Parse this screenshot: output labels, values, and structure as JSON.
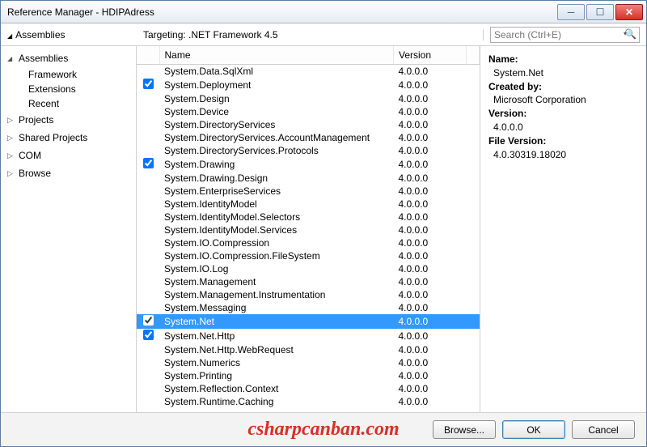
{
  "window": {
    "title": "Reference Manager - HDIPAdress"
  },
  "toprow": {
    "assemblies_label": "Assemblies",
    "targeting": "Targeting: .NET Framework 4.5",
    "search_placeholder": "Search (Ctrl+E)"
  },
  "sidebar": {
    "categories": [
      {
        "label": "Assemblies",
        "expanded": true,
        "children": [
          {
            "label": "Framework",
            "selected": true
          },
          {
            "label": "Extensions"
          },
          {
            "label": "Recent"
          }
        ]
      },
      {
        "label": "Projects",
        "expanded": false
      },
      {
        "label": "Shared Projects",
        "expanded": false
      },
      {
        "label": "COM",
        "expanded": false
      },
      {
        "label": "Browse",
        "expanded": false
      }
    ]
  },
  "columns": {
    "name": "Name",
    "version": "Version"
  },
  "assemblies": [
    {
      "name": "System.Data.SqlXml",
      "version": "4.0.0.0",
      "checked": false
    },
    {
      "name": "System.Deployment",
      "version": "4.0.0.0",
      "checked": true
    },
    {
      "name": "System.Design",
      "version": "4.0.0.0",
      "checked": false
    },
    {
      "name": "System.Device",
      "version": "4.0.0.0",
      "checked": false
    },
    {
      "name": "System.DirectoryServices",
      "version": "4.0.0.0",
      "checked": false
    },
    {
      "name": "System.DirectoryServices.AccountManagement",
      "version": "4.0.0.0",
      "checked": false
    },
    {
      "name": "System.DirectoryServices.Protocols",
      "version": "4.0.0.0",
      "checked": false
    },
    {
      "name": "System.Drawing",
      "version": "4.0.0.0",
      "checked": true
    },
    {
      "name": "System.Drawing.Design",
      "version": "4.0.0.0",
      "checked": false
    },
    {
      "name": "System.EnterpriseServices",
      "version": "4.0.0.0",
      "checked": false
    },
    {
      "name": "System.IdentityModel",
      "version": "4.0.0.0",
      "checked": false
    },
    {
      "name": "System.IdentityModel.Selectors",
      "version": "4.0.0.0",
      "checked": false
    },
    {
      "name": "System.IdentityModel.Services",
      "version": "4.0.0.0",
      "checked": false
    },
    {
      "name": "System.IO.Compression",
      "version": "4.0.0.0",
      "checked": false
    },
    {
      "name": "System.IO.Compression.FileSystem",
      "version": "4.0.0.0",
      "checked": false
    },
    {
      "name": "System.IO.Log",
      "version": "4.0.0.0",
      "checked": false
    },
    {
      "name": "System.Management",
      "version": "4.0.0.0",
      "checked": false
    },
    {
      "name": "System.Management.Instrumentation",
      "version": "4.0.0.0",
      "checked": false
    },
    {
      "name": "System.Messaging",
      "version": "4.0.0.0",
      "checked": false
    },
    {
      "name": "System.Net",
      "version": "4.0.0.0",
      "checked": true,
      "selected": true
    },
    {
      "name": "System.Net.Http",
      "version": "4.0.0.0",
      "checked": true
    },
    {
      "name": "System.Net.Http.WebRequest",
      "version": "4.0.0.0",
      "checked": false
    },
    {
      "name": "System.Numerics",
      "version": "4.0.0.0",
      "checked": false
    },
    {
      "name": "System.Printing",
      "version": "4.0.0.0",
      "checked": false
    },
    {
      "name": "System.Reflection.Context",
      "version": "4.0.0.0",
      "checked": false
    },
    {
      "name": "System.Runtime.Caching",
      "version": "4.0.0.0",
      "checked": false
    }
  ],
  "details": {
    "labels": {
      "name": "Name:",
      "created_by": "Created by:",
      "version": "Version:",
      "file_version": "File Version:"
    },
    "name": "System.Net",
    "created_by": "Microsoft Corporation",
    "version": "4.0.0.0",
    "file_version": "4.0.30319.18020"
  },
  "footer": {
    "browse": "Browse...",
    "ok": "OK",
    "cancel": "Cancel"
  },
  "watermark": "csharpcanban.com"
}
